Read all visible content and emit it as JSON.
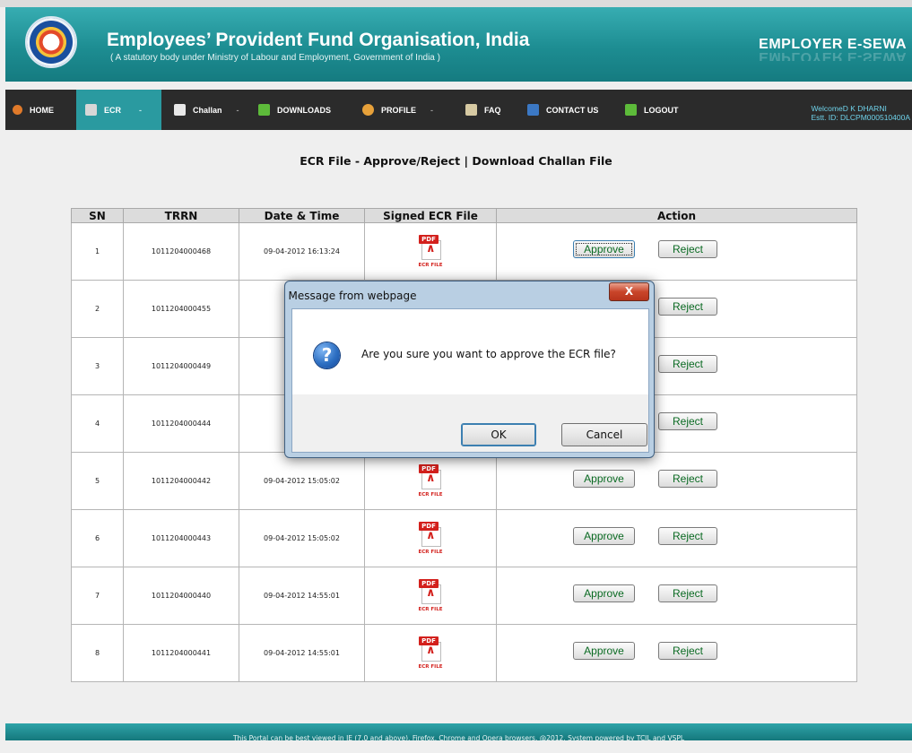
{
  "header": {
    "title": "Employees’ Provident Fund Organisation, India",
    "subtitle": "( A statutory body under Ministry of Labour and Employment, Government of India )",
    "brand": "EMPLOYER E-SEWA"
  },
  "nav": {
    "items": [
      {
        "label": "HOME"
      },
      {
        "label": "ECR"
      },
      {
        "label": "Challan"
      },
      {
        "label": "DOWNLOADS"
      },
      {
        "label": "PROFILE"
      },
      {
        "label": "FAQ"
      },
      {
        "label": "CONTACT US"
      },
      {
        "label": "LOGOUT"
      }
    ],
    "welcome": "WelcomeD K DHARNI",
    "estt_id": "Estt. ID: DLCPM000510400A",
    "sep": "-"
  },
  "page": {
    "heading": "ECR File - Approve/Reject | Download Challan File"
  },
  "table": {
    "headers": [
      "SN",
      "TRRN",
      "Date & Time",
      "Signed ECR File",
      "Action"
    ],
    "pdf_tag": "PDF",
    "pdf_caption": "ECR FILE",
    "approve_label": "Approve",
    "reject_label": "Reject",
    "rows": [
      {
        "sn": "1",
        "trrn": "1011204000468",
        "datetime": "09-04-2012 16:13:24"
      },
      {
        "sn": "2",
        "trrn": "1011204000455",
        "datetime": "09-"
      },
      {
        "sn": "3",
        "trrn": "1011204000449",
        "datetime": "09-"
      },
      {
        "sn": "4",
        "trrn": "1011204000444",
        "datetime": "09-"
      },
      {
        "sn": "5",
        "trrn": "1011204000442",
        "datetime": "09-04-2012 15:05:02"
      },
      {
        "sn": "6",
        "trrn": "1011204000443",
        "datetime": "09-04-2012 15:05:02"
      },
      {
        "sn": "7",
        "trrn": "1011204000440",
        "datetime": "09-04-2012 14:55:01"
      },
      {
        "sn": "8",
        "trrn": "1011204000441",
        "datetime": "09-04-2012 14:55:01"
      }
    ]
  },
  "dialog": {
    "title": "Message from webpage",
    "close": "X",
    "icon": "question-icon",
    "message": "Are you sure you want to approve the ECR file?",
    "ok": "OK",
    "cancel": "Cancel"
  },
  "footer": {
    "text": "This Portal can be best viewed in IE (7.0 and above), Firefox, Chrome and Opera browsers.      @2012, System powered by TCIL and VSPL"
  },
  "colors": {
    "header_teal": "#1d8d92",
    "nav_bg": "#2b2b2b",
    "nav_active": "#2a9aa0",
    "button_text_green": "#0a6a22",
    "pdf_red": "#d3201c"
  }
}
